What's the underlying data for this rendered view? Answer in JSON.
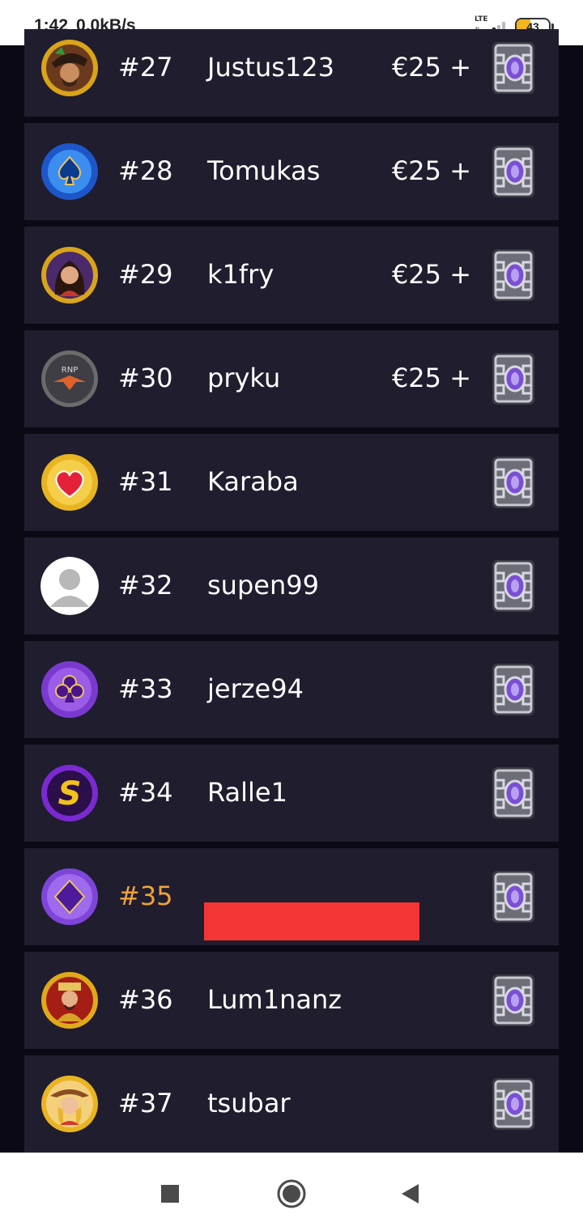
{
  "status_bar": {
    "time": "1:42",
    "net_speed": "0,0kB/s",
    "network": "LTE",
    "battery": "43",
    "battery_level": 0.43
  },
  "colors": {
    "background": "#0b0a14",
    "row_bg": "#1f1d2e",
    "current_user_rank": "#f0a23b",
    "redaction": "#f43535"
  },
  "leaderboard": {
    "rows": [
      {
        "rank": "#27",
        "name": "Justus123",
        "prize": "€25 +",
        "avatar": "pirate-avatar-icon",
        "reward": "mystery-chest-icon"
      },
      {
        "rank": "#28",
        "name": "Tomukas",
        "prize": "€25 +",
        "avatar": "spade-avatar-icon",
        "reward": "mystery-chest-icon"
      },
      {
        "rank": "#29",
        "name": "k1fry",
        "prize": "€25 +",
        "avatar": "woman-avatar-icon",
        "reward": "mystery-chest-icon"
      },
      {
        "rank": "#30",
        "name": "pryku",
        "prize": "€25 +",
        "avatar": "casino-logo-avatar-icon",
        "logo_text": "RNP",
        "reward": "mystery-chest-icon"
      },
      {
        "rank": "#31",
        "name": "Karaba",
        "prize": "",
        "avatar": "heart-avatar-icon",
        "reward": "mystery-chest-icon"
      },
      {
        "rank": "#32",
        "name": "supen99",
        "prize": "",
        "avatar": "default-user-avatar-icon",
        "reward": "mystery-chest-icon"
      },
      {
        "rank": "#33",
        "name": "jerze94",
        "prize": "",
        "avatar": "club-avatar-icon",
        "reward": "mystery-chest-icon"
      },
      {
        "rank": "#34",
        "name": "Ralle1",
        "prize": "",
        "avatar": "s-letter-avatar-icon",
        "reward": "mystery-chest-icon"
      },
      {
        "rank": "#35",
        "name": "",
        "prize": "",
        "avatar": "diamond-avatar-icon",
        "reward": "mystery-chest-icon",
        "current_user": true,
        "name_redacted": true
      },
      {
        "rank": "#36",
        "name": "Lum1nanz",
        "prize": "",
        "avatar": "emperor-avatar-icon",
        "reward": "mystery-chest-icon"
      },
      {
        "rank": "#37",
        "name": "tsubar",
        "prize": "",
        "avatar": "cowgirl-avatar-icon",
        "reward": "mystery-chest-icon"
      }
    ]
  },
  "nav_bar": {
    "recents": "recents-square-icon",
    "home": "home-circle-icon",
    "back": "back-triangle-icon"
  }
}
